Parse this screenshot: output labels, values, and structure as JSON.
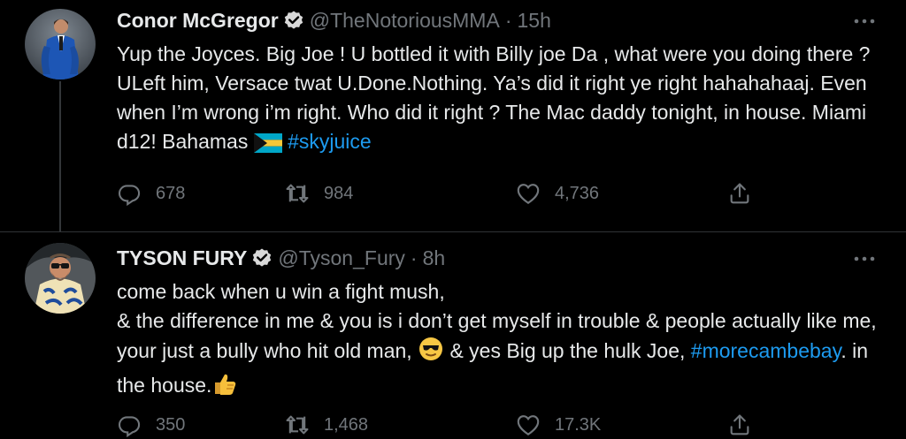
{
  "tweets": [
    {
      "name": "Conor McGregor",
      "handle": "@TheNotoriousMMA",
      "separator": "·",
      "time": "15h",
      "text_before_hashtag": "Yup the Joyces. Big Joe ! U bottled it with Billy joe Da , what were you doing there ? ULeft him, Versace twat U.Done.Nothing. Ya’s did it right ye right hahahahaaj. Even when I’m wrong i’m right. Who did it right ? The Mac daddy tonight, in house. Miami d12! Bahamas ",
      "flag_emoji": "bahamas-flag",
      "hashtag": "#skyjuice",
      "replies": "678",
      "retweets": "984",
      "likes": "4,736"
    },
    {
      "name": "TYSON FURY",
      "handle": "@Tyson_Fury",
      "separator": "·",
      "time": "8h",
      "line1": "come back when u win a fight mush,",
      "line2_before_emoji": "& the difference in me & you is i don’t get myself in trouble & people actually like me, your just a bully who hit old man, ",
      "line2_after_emoji": " & yes Big up the hulk Joe, ",
      "hashtag": "#morecambebay",
      "line2_end": ". in the house.",
      "emoji_1": "sunglasses-face",
      "emoji_2": "thumbs-up",
      "replies": "350",
      "retweets": "1,468",
      "likes": "17.3K"
    }
  ],
  "colors": {
    "background": "#000000",
    "text": "#e7e9ea",
    "muted": "#71767b",
    "hashtag": "#1d9bf0",
    "verified": "#d9d9d9"
  },
  "icons": {
    "more": "more-icon",
    "reply": "reply-icon",
    "retweet": "retweet-icon",
    "like": "like-icon",
    "share": "share-icon"
  }
}
